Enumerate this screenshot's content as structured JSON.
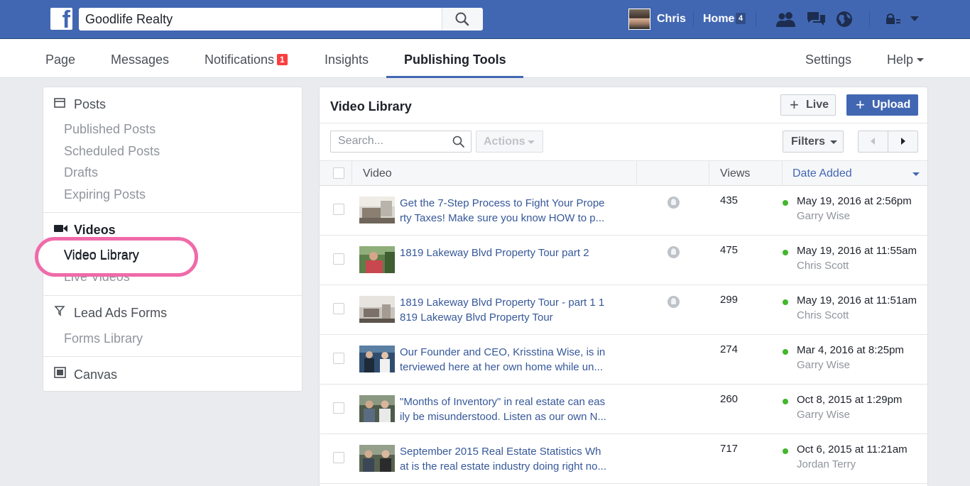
{
  "topbar": {
    "search_value": "Goodlife Realty",
    "profile_name": "Chris",
    "home_label": "Home",
    "home_count": "4"
  },
  "page_tabs": {
    "page": "Page",
    "messages": "Messages",
    "notifications": "Notifications",
    "notifications_count": "1",
    "insights": "Insights",
    "publishing_tools": "Publishing Tools",
    "settings": "Settings",
    "help": "Help"
  },
  "sidebar": {
    "posts_header": "Posts",
    "posts_items": [
      "Published Posts",
      "Scheduled Posts",
      "Drafts",
      "Expiring Posts"
    ],
    "videos_header": "Videos",
    "videos_items": [
      "Video Library",
      "Live Videos"
    ],
    "lead_ads_header": "Lead Ads Forms",
    "lead_ads_items": [
      "Forms Library"
    ],
    "canvas_header": "Canvas"
  },
  "main": {
    "title": "Video Library",
    "live_button": "Live",
    "upload_button": "Upload",
    "search_placeholder": "Search...",
    "actions_button": "Actions",
    "filters_button": "Filters",
    "columns": {
      "video": "Video",
      "views": "Views",
      "date_added": "Date Added"
    },
    "rows": [
      {
        "title_line1": "Get the 7-Step Process to Fight Your Prope",
        "title_line2": "rty Taxes! Make sure you know HOW to p...",
        "views": "435",
        "date": "May 19, 2016 at 2:56pm",
        "author": "Garry Wise"
      },
      {
        "title_line1": "1819 Lakeway Blvd Property Tour part 2",
        "title_line2": "",
        "views": "475",
        "date": "May 19, 2016 at 11:55am",
        "author": "Chris Scott"
      },
      {
        "title_line1": "1819 Lakeway Blvd Property Tour - part 1 1",
        "title_line2": "819 Lakeway Blvd Property Tour",
        "views": "299",
        "date": "May 19, 2016 at 11:51am",
        "author": "Chris Scott"
      },
      {
        "title_line1": "Our Founder and CEO, Krisstina Wise, is in",
        "title_line2": "terviewed here at her own home while un...",
        "views": "274",
        "date": "Mar 4, 2016 at 8:25pm",
        "author": "Garry Wise"
      },
      {
        "title_line1": "\"Months of Inventory\" in real estate can eas",
        "title_line2": "ily be misunderstood. Listen as our own N...",
        "views": "260",
        "date": "Oct 8, 2015 at 1:29pm",
        "author": "Garry Wise"
      },
      {
        "title_line1": "September 2015 Real Estate Statistics Wh",
        "title_line2": "at is the real estate industry doing right no...",
        "views": "717",
        "date": "Oct 6, 2015 at 11:21am",
        "author": "Jordan Terry"
      }
    ]
  },
  "colors": {
    "brand_blue": "#4267b2",
    "link_blue": "#365899",
    "highlight_pink": "#f06aa9",
    "status_green": "#42b72a",
    "badge_red": "#fa3e3e"
  },
  "icons": {
    "facebook_logo": "facebook-logo",
    "search": "search-icon",
    "friends": "friends-icon",
    "messages": "messages-icon",
    "globe": "globe-icon",
    "lock": "lock-icon",
    "posts": "posts-icon",
    "videos": "video-camera-icon",
    "lead_ads": "funnel-icon",
    "canvas": "canvas-icon"
  }
}
